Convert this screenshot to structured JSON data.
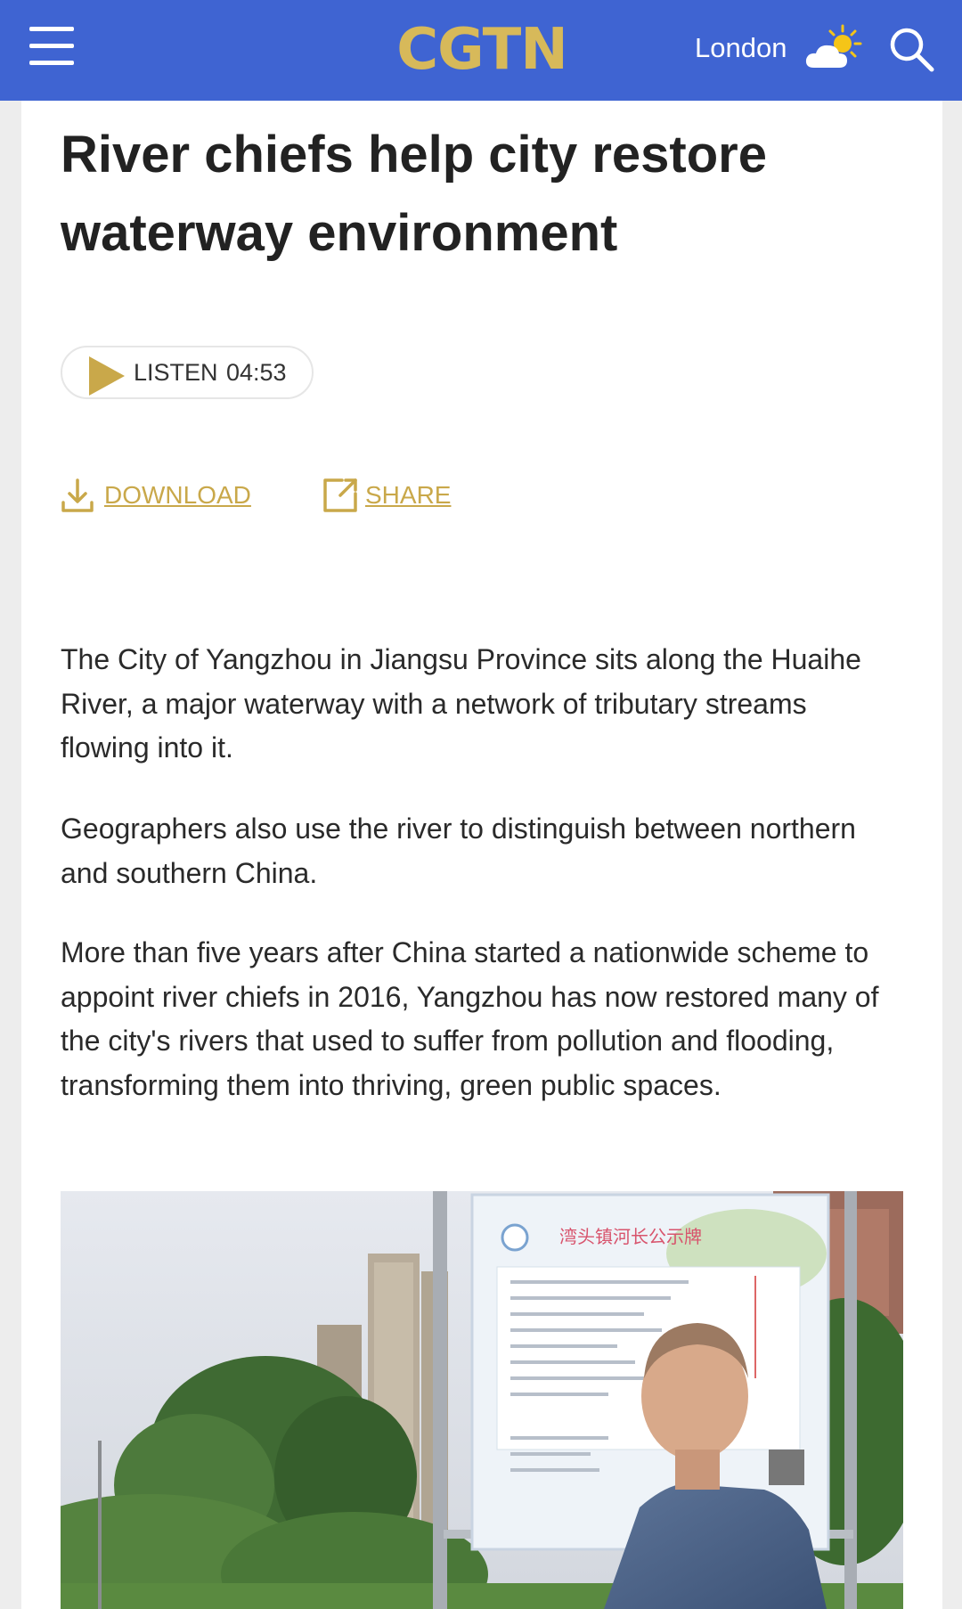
{
  "header": {
    "logo": "CGTN",
    "city": "London",
    "icons": {
      "menu": "hamburger-menu-icon",
      "weather": "partly-cloudy-icon",
      "search": "search-icon"
    },
    "background": "#3f64d2",
    "logo_color": "#d7b95a"
  },
  "article": {
    "title": "River chiefs help city restore waterway environment",
    "listen": {
      "label": "LISTEN",
      "duration": "04:53"
    },
    "actions": {
      "download": "DOWNLOAD",
      "share": "SHARE"
    },
    "accent_color": "#c9a84a",
    "paragraphs": [
      "The City of Yangzhou in Jiangsu Province sits along the Huaihe River, a major waterway with a network of tributary streams flowing into it.",
      "Geographers also use the river to distinguish between northern and southern China.",
      "More than five years after China started a nationwide scheme to appoint river chiefs in 2016, Yangzhou has now restored many of the city's rivers that used to suffer from pollution and flooding, transforming them into thriving, green public spaces."
    ],
    "photo": {
      "sign_title": "湾头镇河长公示牌"
    }
  }
}
